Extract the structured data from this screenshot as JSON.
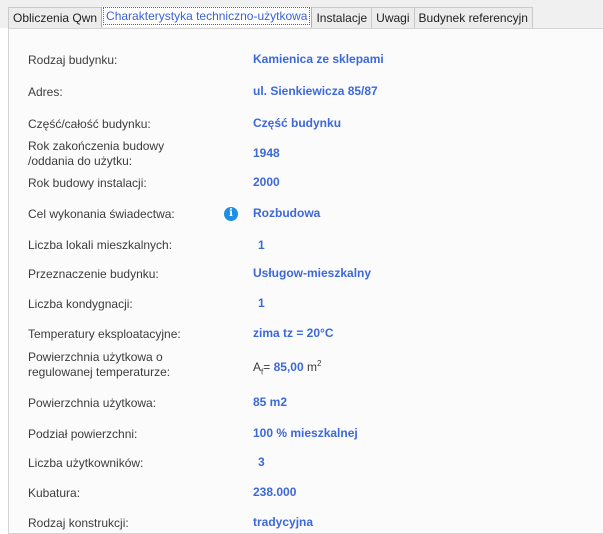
{
  "tabs": [
    {
      "label": "Obliczenia Qwn",
      "active": false
    },
    {
      "label": "Charakterystyka techniczno-użytkowa",
      "active": true
    },
    {
      "label": "Instalacje",
      "active": false
    },
    {
      "label": "Uwagi",
      "active": false
    },
    {
      "label": "Budynek referencyjn",
      "active": false
    }
  ],
  "fields": {
    "building_type": {
      "label": "Rodzaj budynku:",
      "value": "Kamienica ze sklepami"
    },
    "address": {
      "label": "Adres:",
      "value": "ul. Sienkiewicza 85/87"
    },
    "part": {
      "label": "Część/całość budynku:",
      "value": "Część budynku"
    },
    "completion_year": {
      "label_line1": "Rok zakończenia budowy",
      "label_line2": "/oddania do użytku:",
      "value": "1948"
    },
    "install_year": {
      "label": "Rok budowy instalacji:",
      "value": "2000"
    },
    "purpose": {
      "label": "Cel wykonania świadectwa:",
      "value": "Rozbudowa",
      "icon": "info-icon"
    },
    "units": {
      "label": "Liczba lokali mieszkalnych:",
      "value": "1"
    },
    "usage": {
      "label": "Przeznaczenie budynku:",
      "value": "Usługow-mieszkalny"
    },
    "floors": {
      "label": "Liczba kondygnacji:",
      "value": "1"
    },
    "temperatures": {
      "label": "Temperatury eksploatacyjne:",
      "value": "zima tz = 20°C"
    },
    "heated_area": {
      "label_line1": "Powierzchnia użytkowa o",
      "label_line2": "regulowanej temperaturze:",
      "symbol": "A",
      "symbol_sub": "f",
      "eq": "=",
      "value": "85,00",
      "unit": "m",
      "unit_sup": "2"
    },
    "usable_area": {
      "label": "Powierzchnia użytkowa:",
      "value": "85 m2"
    },
    "area_split": {
      "label": "Podział powierzchni:",
      "value": "100 % mieszkalnej"
    },
    "users": {
      "label": "Liczba użytkowników:",
      "value": "3"
    },
    "volume": {
      "label": "Kubatura:",
      "value": "238.000"
    },
    "construction": {
      "label": "Rodzaj konstrukcji:",
      "value": "tradycyjna"
    }
  }
}
